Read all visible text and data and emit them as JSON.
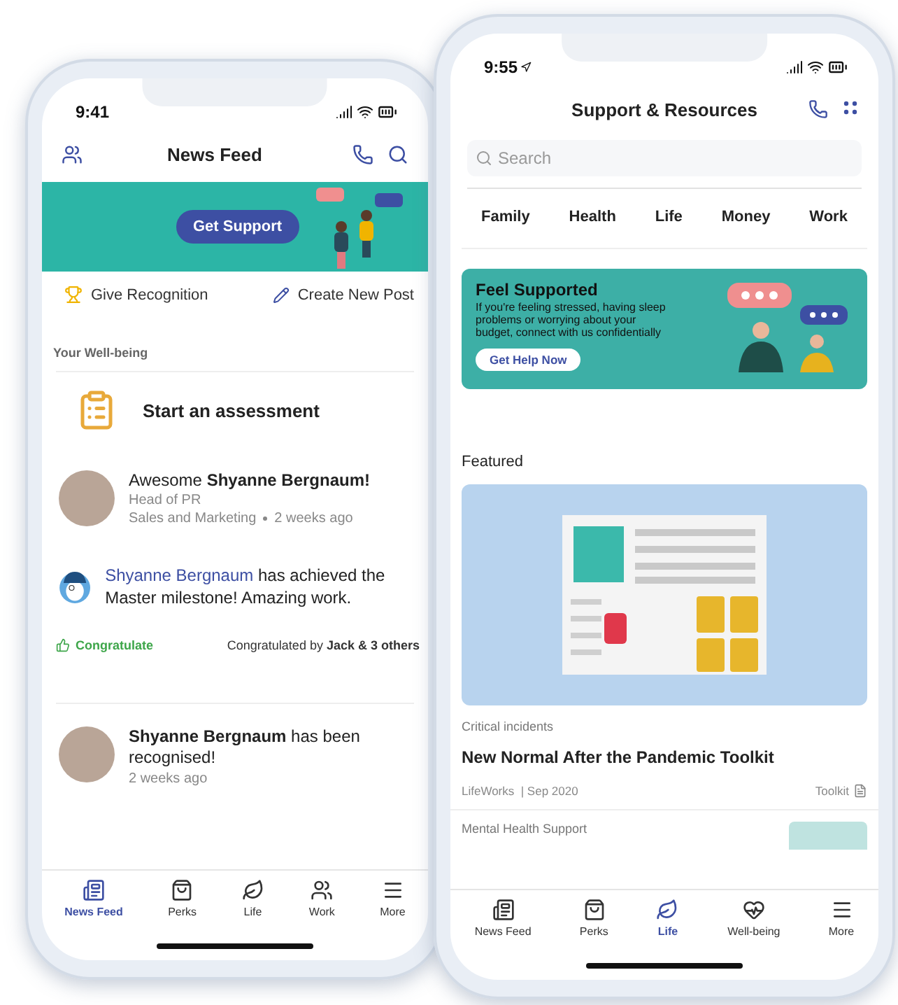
{
  "news_feed_phone": {
    "time": "9:41",
    "title": "News Feed",
    "banner_button": "Get Support",
    "actions": [
      {
        "kind": "trophy",
        "label": "Give Recognition"
      },
      {
        "kind": "pencil",
        "label": "Create New Post"
      }
    ],
    "section": "Your Well-being",
    "assessment": "Start an assessment",
    "recognition": {
      "headline": "Awesome **Shyanne Bergnaum!**",
      "role": "Head of PR",
      "team": "Sales and Marketing",
      "time": "2 weeks ago"
    },
    "milestone": {
      "link": "Shyanne Bergnaum",
      "text": " has achieved the Master milestone! Amazing work.",
      "congratulate": "Congratulate",
      "congratulated_by": "Congratulated by **Jack & 3 others**"
    },
    "recognised": {
      "headline": "**Shyanne Bergnaum** has been recognised!",
      "time": "2 weeks ago"
    },
    "nav": [
      {
        "kind": "feed",
        "label": "News Feed",
        "selected": true
      },
      {
        "kind": "bag",
        "label": "Perks",
        "selected": false
      },
      {
        "kind": "leaf",
        "label": "Life",
        "selected": false
      },
      {
        "kind": "people",
        "label": "Work",
        "selected": false
      },
      {
        "kind": "menu",
        "label": "More",
        "selected": false
      }
    ]
  },
  "resources_phone": {
    "time": "9:55",
    "title": "Support & Resources",
    "search_placeholder": "Search",
    "categories": [
      "Family",
      "Health",
      "Life",
      "Money",
      "Work"
    ],
    "banner": {
      "title": "Feel Supported",
      "body": "If you're feeling stressed, having sleep problems or worrying about your budget, connect with us confidentially",
      "button": "Get Help Now"
    },
    "featured": "Featured",
    "article": {
      "category": "Critical incidents",
      "title": "New Normal After the Pandemic Toolkit",
      "source": "LifeWorks  | Sep 2020",
      "type": "Toolkit"
    },
    "next_category": "Mental Health Support",
    "nav": [
      {
        "kind": "feed",
        "label": "News Feed",
        "selected": false
      },
      {
        "kind": "bag",
        "label": "Perks",
        "selected": false
      },
      {
        "kind": "leaf",
        "label": "Life",
        "selected": true
      },
      {
        "kind": "heart",
        "label": "Well-being",
        "selected": false
      },
      {
        "kind": "menu",
        "label": "More",
        "selected": false
      }
    ]
  }
}
